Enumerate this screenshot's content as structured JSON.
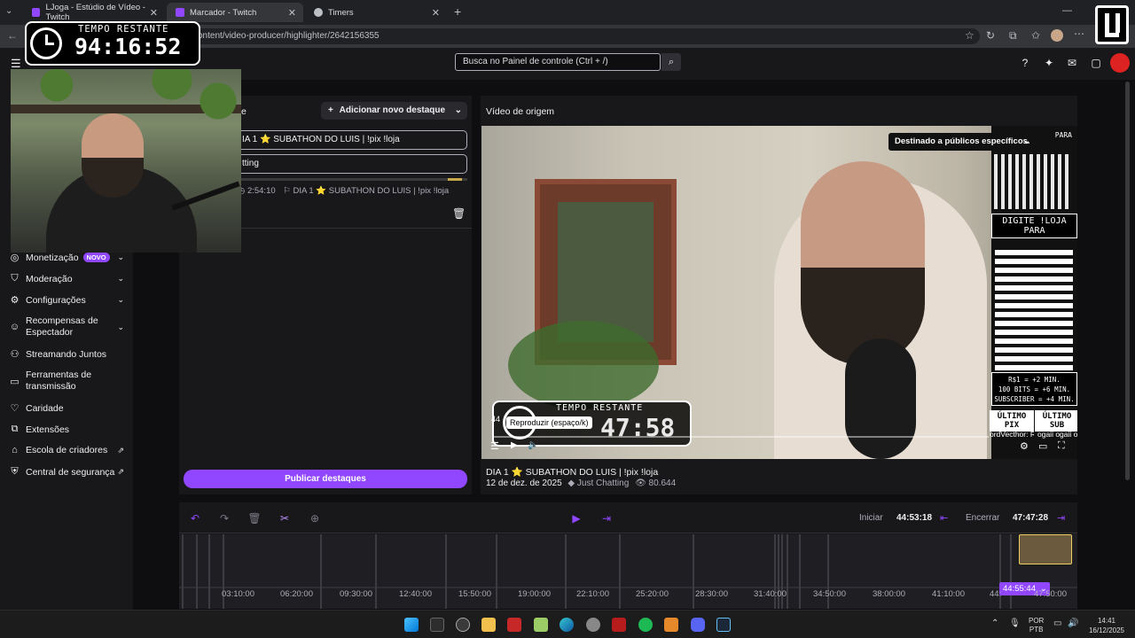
{
  "browser": {
    "tabs": [
      {
        "title": "LJoga - Estúdio de Vídeo - Twitch",
        "active": false
      },
      {
        "title": "Marcador - Twitch",
        "active": true
      },
      {
        "title": "Timers",
        "active": false
      }
    ],
    "url": "content/video-producer/highlighter/2642156355"
  },
  "header": {
    "search_placeholder": "Busca no Painel de controle (Ctrl + /)"
  },
  "sidebar": {
    "items": [
      {
        "label": "Monetização",
        "icon": "money-icon",
        "badge": "NOVO",
        "chevron": true
      },
      {
        "label": "Moderação",
        "icon": "shield-icon",
        "chevron": true
      },
      {
        "label": "Configurações",
        "icon": "gear-icon",
        "chevron": true
      },
      {
        "label": "Recompensas de Espectador",
        "icon": "reward-icon",
        "chevron": true
      },
      {
        "label": "Streamando Juntos",
        "icon": "together-icon",
        "chevron": false
      },
      {
        "label": "Ferramentas de transmissão",
        "icon": "broadcast-tools-icon",
        "chevron": false
      },
      {
        "label": "Caridade",
        "icon": "charity-icon",
        "chevron": false
      },
      {
        "label": "Extensões",
        "icon": "extensions-icon",
        "chevron": false
      },
      {
        "label": "Escola de criadores",
        "icon": "school-icon",
        "external": true
      },
      {
        "label": "Central de segurança",
        "icon": "safety-icon",
        "external": true
      }
    ]
  },
  "highlights": {
    "add_button": "Adicionar novo destaque",
    "title_field": "IA 1 ⭐ SUBATHON DO LUIS | !pix !loja",
    "category_field": "tting",
    "meta_duration": "2:54:10",
    "meta_title": "DIA 1 ⭐ SUBATHON DO LUIS | !pix !loja",
    "publish_button": "Publicar destaques",
    "partial_header": "e"
  },
  "source_video": {
    "heading": "Vídeo de origem",
    "audience_dropdown": "Destinado a públicos específicos.",
    "tooltip": "Reproduzir (espaço/k)",
    "timer_label": "TEMPO RESTANTE",
    "timer_value": "47:58",
    "timer_prefix": "44",
    "title": "DIA 1 ⭐ SUBATHON DO LUIS | !pix !loja",
    "date": "12 de dez. de 2025",
    "category": "Just Chatting",
    "views": "80.644",
    "overlay": {
      "top_label": "PARA",
      "loja_text": "DIGITE !LOJA PARA",
      "rates": [
        "R$1 = +2 MIN.",
        "100 BITS = +6 MIN.",
        "SUBSCRIBER = +4 MIN."
      ],
      "ultimo_pix": "ÚLTIMO PIX",
      "ultimo_sub": "ÚLTIMO SUB",
      "ticker": "ordVecthor: R$!",
      "ticker2": "ogaii ogaii og"
    }
  },
  "timeline": {
    "start_label": "Iniciar",
    "start_value": "44:53:18",
    "end_label": "Encerrar",
    "end_value": "47:47:28",
    "playhead": "44:55:44",
    "ticks": [
      "03:10:00",
      "06:20:00",
      "09:30:00",
      "12:40:00",
      "15:50:00",
      "19:00:00",
      "22:10:00",
      "25:20:00",
      "28:30:00",
      "31:40:00",
      "34:50:00",
      "38:00:00",
      "41:10:00",
      "44:",
      "47:50:00"
    ]
  },
  "stream_overlay": {
    "timer_label": "TEMPO RESTANTE",
    "timer_value": "94:16:52"
  },
  "taskbar": {
    "lang_top": "POR",
    "lang_bottom": "PTB",
    "time": "14:41",
    "date": "16/12/2025"
  },
  "colors": {
    "accent": "#9147ff",
    "background": "#0e0e10",
    "panel": "#18181b",
    "highlight_region": "#6b5a3e",
    "highlight_border": "#f0d060"
  }
}
